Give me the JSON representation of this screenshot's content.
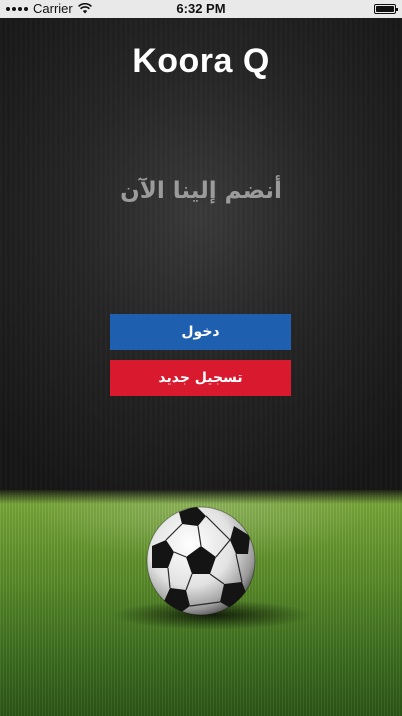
{
  "status_bar": {
    "carrier": "Carrier",
    "time": "6:32 PM",
    "icons": [
      "signal-icon",
      "wifi-icon",
      "battery-icon"
    ]
  },
  "app": {
    "title": "Koora Q"
  },
  "main": {
    "join_text": "أنضم إلينا الآن",
    "login_label": "دخول",
    "register_label": "تسجيل جديد"
  },
  "colors": {
    "login_button": "#1f5fb0",
    "register_button": "#d8192e",
    "title": "#ffffff",
    "join_text": "#9b9b9b"
  },
  "background": {
    "image": "soccer-ball-on-grass"
  }
}
